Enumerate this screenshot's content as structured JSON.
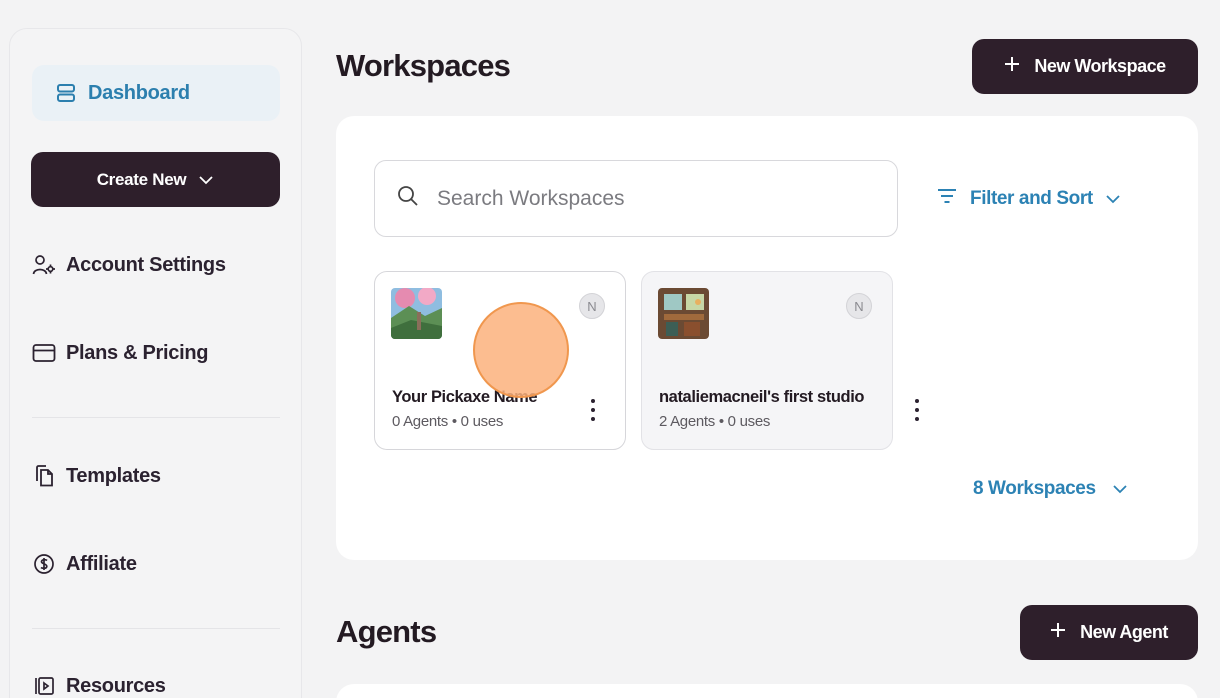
{
  "sidebar": {
    "items": [
      {
        "label": "Dashboard",
        "icon": "dashboard-icon",
        "active": true
      },
      {
        "label": "Account Settings",
        "icon": "account-settings-icon"
      },
      {
        "label": "Plans & Pricing",
        "icon": "credit-card-icon"
      },
      {
        "label": "Templates",
        "icon": "templates-icon"
      },
      {
        "label": "Affiliate",
        "icon": "dollar-circle-icon"
      },
      {
        "label": "Resources",
        "icon": "resources-icon"
      }
    ],
    "create_new_label": "Create New"
  },
  "workspaces": {
    "title": "Workspaces",
    "new_button_label": "New Workspace",
    "search_placeholder": "Search Workspaces",
    "filter_label": "Filter and Sort",
    "cards": [
      {
        "name": "Your Pickaxe Name",
        "meta": "0 Agents • 0 uses",
        "badge": "N",
        "thumbnail": "landscape-thumbnail"
      },
      {
        "name": "nataliemacneil's first studio",
        "meta": "2 Agents • 0 uses",
        "badge": "N",
        "thumbnail": "room-thumbnail"
      }
    ],
    "count_label": "8 Workspaces"
  },
  "agents": {
    "title": "Agents",
    "new_button_label": "New Agent"
  },
  "colors": {
    "accent": "#2c82b4",
    "dark_button": "#2e1f2b",
    "active_nav_bg": "#eaf1f6",
    "cursor_highlight": "#fcb27c"
  }
}
